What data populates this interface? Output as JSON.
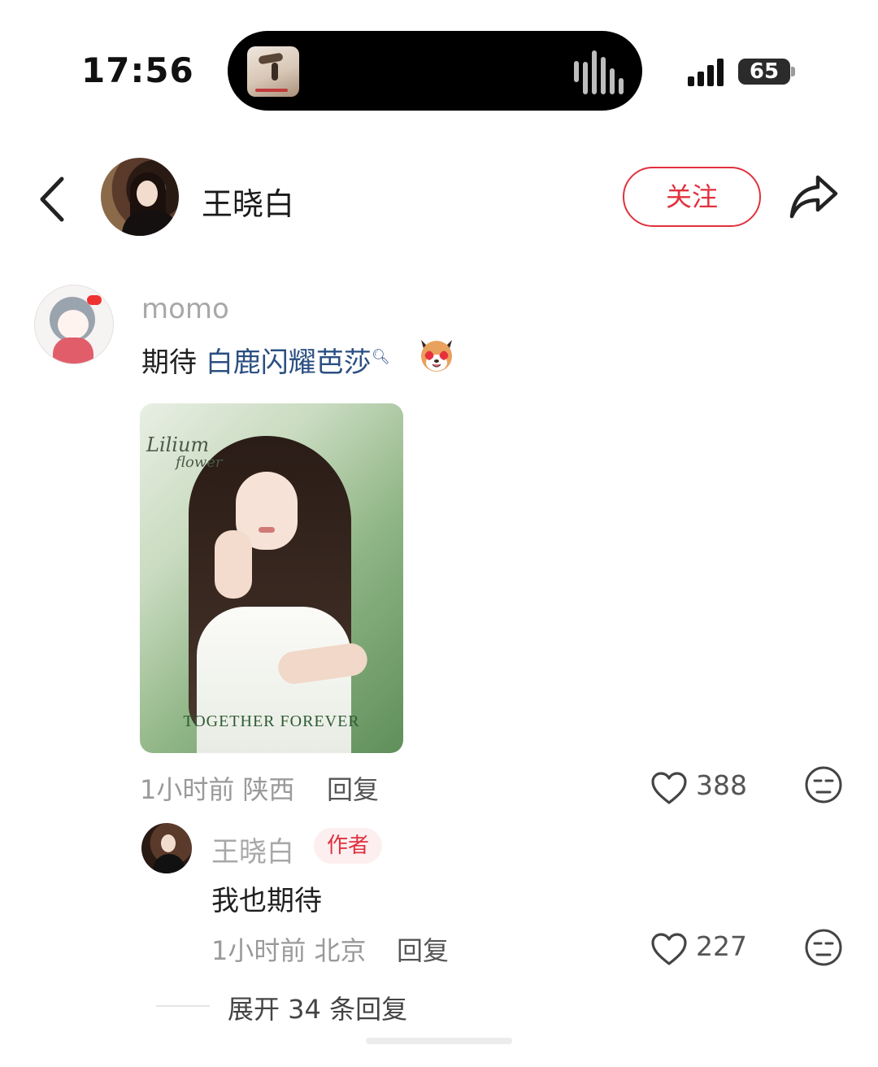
{
  "status_bar": {
    "time": "17:56",
    "battery": "65",
    "icons": [
      "signal-icon",
      "battery-icon",
      "waveform-icon"
    ]
  },
  "header": {
    "name": "王晓白",
    "follow_label": "关注",
    "icons": [
      "back-arrow-icon",
      "share-icon"
    ]
  },
  "comment": {
    "username": "momo",
    "text_prefix": "期待 ",
    "link_text": "白鹿闪耀芭莎",
    "image": {
      "script_text_1": "Lilium",
      "script_text_2": "flower",
      "footer_text": "TOGETHER FOREVER"
    },
    "meta": "1小时前 陕西",
    "reply_label": "回复",
    "likes": "388"
  },
  "reply": {
    "username": "王晓白",
    "badge": "作者",
    "text": "我也期待",
    "meta": "1小时前 北京",
    "reply_label": "回复",
    "likes": "227"
  },
  "expand": {
    "label": "展开 34 条回复"
  },
  "colors": {
    "accent_red": "#e0323e",
    "link_blue": "#2b4f82",
    "muted_gray": "#9a9a9a"
  }
}
